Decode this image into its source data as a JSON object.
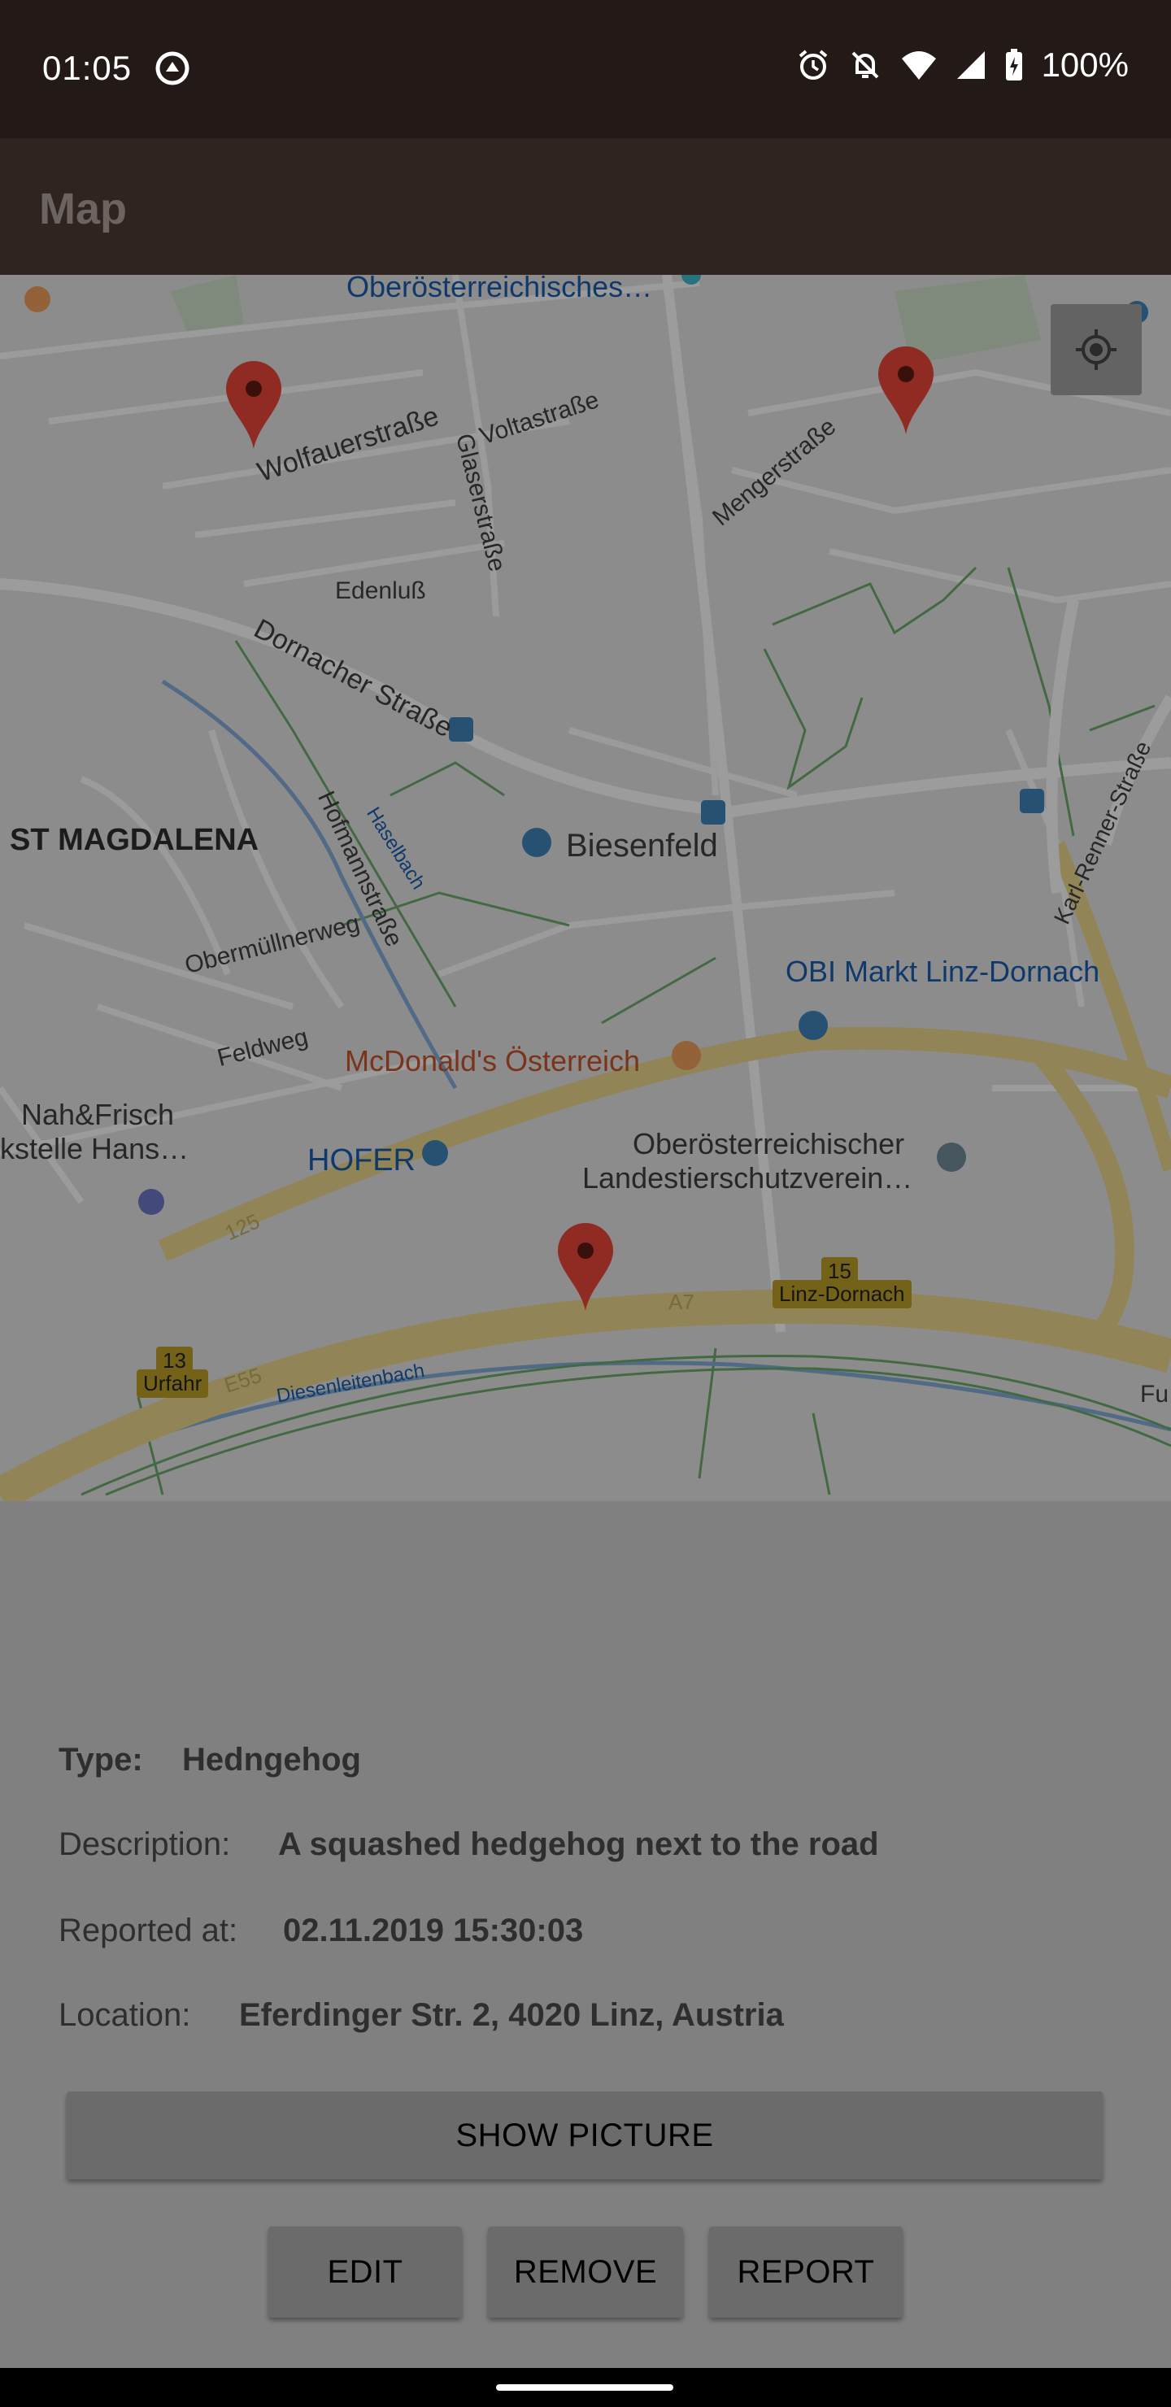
{
  "status_bar": {
    "time": "01:05",
    "battery": "100%",
    "icons": [
      "app-sync-icon",
      "alarm-icon",
      "notifications-off-icon",
      "wifi-icon",
      "signal-icon",
      "battery-charging-icon"
    ]
  },
  "app_bar": {
    "title": "Map"
  },
  "map": {
    "labels": {
      "oberoesterreichisches": "Oberösterreichisches…",
      "wolfauerstrasse": "Wolfauerstraße",
      "voltastrasse": "Voltastraße",
      "glaserstrasse": "Glaserstraße",
      "mengerstrasse": "Mengerstraße",
      "edenluss": "Edenluß",
      "dornacher_strasse": "Dornacher Straße",
      "st_magdalena": "ST MAGDALENA",
      "biesenfeld": "Biesenfeld",
      "hofmannstrasse": "Hofmannstraße",
      "haselbach": "Haselbach",
      "karl_renner_strasse": "Karl-Renner-Straße",
      "obermuellnerweg": "Obermüllnerweg",
      "obi": "OBI Markt Linz-Dornach",
      "feldweg": "Feldweg",
      "mcdonalds": "McDonald's Österreich",
      "nah_frisch_1": "Nah&Frisch",
      "nah_frisch_2": "kstelle Hans…",
      "hofer": "HOFER",
      "tierschutz_1": "Oberösterreichischer",
      "tierschutz_2": "Landestierschutzverein…",
      "linz_dornach": "Linz-Dornach",
      "urfahr": "Urfahr",
      "diesenleitenbach": "Diesenleitenbach",
      "a7": "A7",
      "e55": "E55",
      "r125": "125",
      "exit_13": "13",
      "exit_15": "15",
      "fu": "Fu"
    }
  },
  "details": {
    "type_label": "Type:",
    "type_value": "Hedngehog",
    "description_label": "Description:",
    "description_value": "A squashed hedgehog next to the road",
    "reported_label": "Reported at:",
    "reported_value": "02.11.2019 15:30:03",
    "location_label": "Location:",
    "location_value": "Eferdinger Str. 2, 4020 Linz, Austria"
  },
  "buttons": {
    "show_picture": "SHOW PICTURE",
    "edit": "EDIT",
    "remove": "REMOVE",
    "report": "REPORT"
  },
  "colors": {
    "status_bar": "#231a18",
    "app_bar": "#2f2420",
    "marker": "#8b1a1a",
    "scrim": "#808080"
  }
}
